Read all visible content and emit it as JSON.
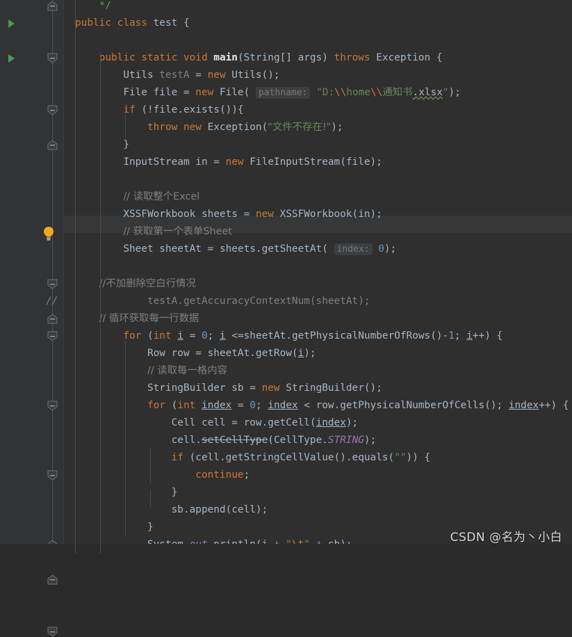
{
  "editor": {
    "theme": "darcula",
    "background": "#2f2f2f",
    "gutter_background": "#313335",
    "current_line_background": "#353739",
    "language": "java",
    "watermark": "CSDN @名为丶小白"
  },
  "colors": {
    "keyword": "#cc7832",
    "string": "#6a8759",
    "number": "#6897bb",
    "comment": "#808080",
    "method": "#ffc66d",
    "static_field": "#9876aa",
    "default_text": "#a9b7c6",
    "run_marker_green": "#4a9b52",
    "bulb_amber": "#f0a81e",
    "javadoc_green": "#629755"
  },
  "gutter": {
    "run_markers": [
      {
        "name": "run-class-marker",
        "line": 1
      },
      {
        "name": "run-main-marker",
        "line": 3
      }
    ],
    "fold_markers": [
      {
        "line": 0,
        "dir": "up"
      },
      {
        "line": 3,
        "dir": "down"
      },
      {
        "line": 6,
        "dir": "down"
      },
      {
        "line": 8,
        "dir": "up"
      },
      {
        "line": 16,
        "dir": "down"
      },
      {
        "line": 18,
        "dir": "up"
      },
      {
        "line": 19,
        "dir": "down"
      },
      {
        "line": 23,
        "dir": "down"
      },
      {
        "line": 27,
        "dir": "down"
      },
      {
        "line": 31,
        "dir": "up"
      },
      {
        "line": 33,
        "dir": "up"
      },
      {
        "line": 36,
        "dir": "down"
      }
    ],
    "bulb": {
      "name": "intention-bulb",
      "line": 13
    },
    "comment_mark": {
      "text": "//",
      "line": 17
    }
  },
  "code": {
    "lines": [
      {
        "indent": 1,
        "tokens": [
          {
            "t": "jdoc",
            "v": "*/"
          }
        ]
      },
      {
        "indent": 0,
        "tokens": [
          {
            "t": "kw",
            "v": "public "
          },
          {
            "t": "kw",
            "v": "class "
          },
          {
            "t": "cls",
            "v": "test"
          },
          {
            "t": "pln",
            "v": " {"
          }
        ]
      },
      {
        "indent": 0,
        "tokens": []
      },
      {
        "indent": 1,
        "tokens": [
          {
            "t": "kw",
            "v": "public "
          },
          {
            "t": "kw",
            "v": "static "
          },
          {
            "t": "kw",
            "v": "void "
          },
          {
            "t": "mainm",
            "v": "main"
          },
          {
            "t": "pln",
            "v": "("
          },
          {
            "t": "cls",
            "v": "String"
          },
          {
            "t": "pln",
            "v": "[] args) "
          },
          {
            "t": "kw",
            "v": "throws "
          },
          {
            "t": "cls",
            "v": "Exception"
          },
          {
            "t": "pln",
            "v": " {"
          }
        ]
      },
      {
        "indent": 2,
        "tokens": [
          {
            "t": "cls",
            "v": "Utils "
          },
          {
            "t": "unused",
            "v": "testA"
          },
          {
            "t": "pln",
            "v": " = "
          },
          {
            "t": "kw",
            "v": "new "
          },
          {
            "t": "cls",
            "v": "Utils"
          },
          {
            "t": "pln",
            "v": "();"
          }
        ]
      },
      {
        "indent": 2,
        "tokens": [
          {
            "t": "cls",
            "v": "File"
          },
          {
            "t": "pln",
            "v": " file = "
          },
          {
            "t": "kw",
            "v": "new "
          },
          {
            "t": "cls",
            "v": "File"
          },
          {
            "t": "pln",
            "v": "( "
          },
          {
            "t": "hint",
            "v": "pathname:"
          },
          {
            "t": "pln",
            "v": " "
          },
          {
            "t": "str",
            "v": "\"D:"
          },
          {
            "t": "esc",
            "v": "\\\\"
          },
          {
            "t": "str",
            "v": "home"
          },
          {
            "t": "esc",
            "v": "\\\\"
          },
          {
            "t": "str-cjk",
            "v": "通知书"
          },
          {
            "t": "typo",
            "v": ".xlsx"
          },
          {
            "t": "str",
            "v": "\""
          },
          {
            "t": "pln",
            "v": ");"
          }
        ]
      },
      {
        "indent": 2,
        "tokens": [
          {
            "t": "kw",
            "v": "if "
          },
          {
            "t": "pln",
            "v": "(!file.exists()){"
          }
        ]
      },
      {
        "indent": 3,
        "tokens": [
          {
            "t": "kw",
            "v": "throw "
          },
          {
            "t": "kw",
            "v": "new "
          },
          {
            "t": "cls",
            "v": "Exception"
          },
          {
            "t": "pln",
            "v": "("
          },
          {
            "t": "str-cjk",
            "v": "\"文件不存在!\""
          },
          {
            "t": "pln",
            "v": ");"
          }
        ]
      },
      {
        "indent": 2,
        "tokens": [
          {
            "t": "pln",
            "v": "}"
          }
        ]
      },
      {
        "indent": 2,
        "tokens": [
          {
            "t": "cls",
            "v": "InputStream"
          },
          {
            "t": "pln",
            "v": " in = "
          },
          {
            "t": "kw",
            "v": "new "
          },
          {
            "t": "cls",
            "v": "FileInputStream"
          },
          {
            "t": "pln",
            "v": "(file);"
          }
        ]
      },
      {
        "indent": 0,
        "tokens": []
      },
      {
        "indent": 2,
        "tokens": [
          {
            "t": "cmt-cjk",
            "v": "// 读取整个Excel"
          }
        ]
      },
      {
        "indent": 2,
        "tokens": [
          {
            "t": "cls",
            "v": "XSSFWorkbook"
          },
          {
            "t": "pln",
            "v": " sheets = "
          },
          {
            "t": "kw",
            "v": "new "
          },
          {
            "t": "cls",
            "v": "XSSFWorkbook"
          },
          {
            "t": "pln",
            "v": "(in);"
          }
        ]
      },
      {
        "indent": 2,
        "tokens": [
          {
            "t": "cmt-cjk",
            "v": "// 获取第一个表单Sheet"
          }
        ]
      },
      {
        "indent": 2,
        "tokens": [
          {
            "t": "cls",
            "v": "Sheet"
          },
          {
            "t": "pln",
            "v": " sheetAt = sheets.getSheetAt( "
          },
          {
            "t": "hint",
            "v": "index:"
          },
          {
            "t": "pln",
            "v": " "
          },
          {
            "t": "num",
            "v": "0"
          },
          {
            "t": "pln",
            "v": ");"
          }
        ]
      },
      {
        "indent": 0,
        "tokens": []
      },
      {
        "indent": 1,
        "tokens": [
          {
            "t": "cmt-cjk",
            "v": "//不加删除空白行情况"
          }
        ]
      },
      {
        "indent": 2,
        "tokens": [
          {
            "t": "cmt",
            "v": "    testA.getAccuracyContextNum(sheetAt);"
          }
        ]
      },
      {
        "indent": 1,
        "tokens": [
          {
            "t": "cmt-cjk",
            "v": "// 循环获取每一行数据"
          }
        ]
      },
      {
        "indent": 2,
        "tokens": [
          {
            "t": "kw",
            "v": "for "
          },
          {
            "t": "pln",
            "v": "("
          },
          {
            "t": "kw",
            "v": "int "
          },
          {
            "t": "localvar",
            "v": "i"
          },
          {
            "t": "pln",
            "v": " = "
          },
          {
            "t": "num",
            "v": "0"
          },
          {
            "t": "pln",
            "v": "; "
          },
          {
            "t": "localvar",
            "v": "i"
          },
          {
            "t": "pln",
            "v": " <=sheetAt.getPhysicalNumberOfRows()-"
          },
          {
            "t": "num",
            "v": "1"
          },
          {
            "t": "pln",
            "v": "; "
          },
          {
            "t": "localvar",
            "v": "i"
          },
          {
            "t": "pln",
            "v": "++) {"
          }
        ]
      },
      {
        "indent": 3,
        "tokens": [
          {
            "t": "cls",
            "v": "Row"
          },
          {
            "t": "pln",
            "v": " row = sheetAt.getRow("
          },
          {
            "t": "localvar",
            "v": "i"
          },
          {
            "t": "pln",
            "v": ");"
          }
        ]
      },
      {
        "indent": 3,
        "tokens": [
          {
            "t": "cmt-cjk",
            "v": "// 读取每一格内容"
          }
        ]
      },
      {
        "indent": 3,
        "tokens": [
          {
            "t": "cls",
            "v": "StringBuilder"
          },
          {
            "t": "pln",
            "v": " sb = "
          },
          {
            "t": "kw",
            "v": "new "
          },
          {
            "t": "cls",
            "v": "StringBuilder"
          },
          {
            "t": "pln",
            "v": "();"
          }
        ]
      },
      {
        "indent": 3,
        "tokens": [
          {
            "t": "kw",
            "v": "for "
          },
          {
            "t": "pln",
            "v": "("
          },
          {
            "t": "kw",
            "v": "int "
          },
          {
            "t": "localvar",
            "v": "index"
          },
          {
            "t": "pln",
            "v": " = "
          },
          {
            "t": "num",
            "v": "0"
          },
          {
            "t": "pln",
            "v": "; "
          },
          {
            "t": "localvar",
            "v": "index"
          },
          {
            "t": "pln",
            "v": " < row.getPhysicalNumberOfCells(); "
          },
          {
            "t": "localvar",
            "v": "index"
          },
          {
            "t": "pln",
            "v": "++) {"
          }
        ]
      },
      {
        "indent": 4,
        "tokens": [
          {
            "t": "cls",
            "v": "Cell"
          },
          {
            "t": "pln",
            "v": " cell = row.getCell("
          },
          {
            "t": "localvar",
            "v": "index"
          },
          {
            "t": "pln",
            "v": ");"
          }
        ]
      },
      {
        "indent": 4,
        "tokens": [
          {
            "t": "pln",
            "v": "cell."
          },
          {
            "t": "deprecated",
            "v": "setCellType"
          },
          {
            "t": "pln",
            "v": "("
          },
          {
            "t": "cls",
            "v": "CellType"
          },
          {
            "t": "pln",
            "v": "."
          },
          {
            "t": "stat",
            "v": "STRING"
          },
          {
            "t": "pln",
            "v": ");"
          }
        ]
      },
      {
        "indent": 4,
        "tokens": [
          {
            "t": "kw",
            "v": "if "
          },
          {
            "t": "pln",
            "v": "(cell.getStringCellValue().equals("
          },
          {
            "t": "str",
            "v": "\"\""
          },
          {
            "t": "pln",
            "v": ")) {"
          }
        ]
      },
      {
        "indent": 5,
        "tokens": [
          {
            "t": "kw",
            "v": "continue"
          },
          {
            "t": "pln",
            "v": ";"
          }
        ]
      },
      {
        "indent": 4,
        "tokens": [
          {
            "t": "pln",
            "v": "}"
          }
        ]
      },
      {
        "indent": 4,
        "tokens": [
          {
            "t": "pln",
            "v": "sb.append(cell);"
          }
        ]
      },
      {
        "indent": 3,
        "tokens": [
          {
            "t": "pln",
            "v": "}"
          }
        ]
      },
      {
        "indent": 3,
        "tokens": [
          {
            "t": "cls",
            "v": "System"
          },
          {
            "t": "pln",
            "v": "."
          },
          {
            "t": "stat",
            "v": "out"
          },
          {
            "t": "pln",
            "v": ".println("
          },
          {
            "t": "localvar",
            "v": "i"
          },
          {
            "t": "pln",
            "v": " + "
          },
          {
            "t": "str",
            "v": "\""
          },
          {
            "t": "esc",
            "v": "\\t"
          },
          {
            "t": "str",
            "v": "\""
          },
          {
            "t": "pln",
            "v": " + sb);"
          }
        ]
      },
      {
        "indent": 3,
        "tokens": [
          {
            "t": "pln",
            "v": "}"
          }
        ]
      }
    ]
  }
}
